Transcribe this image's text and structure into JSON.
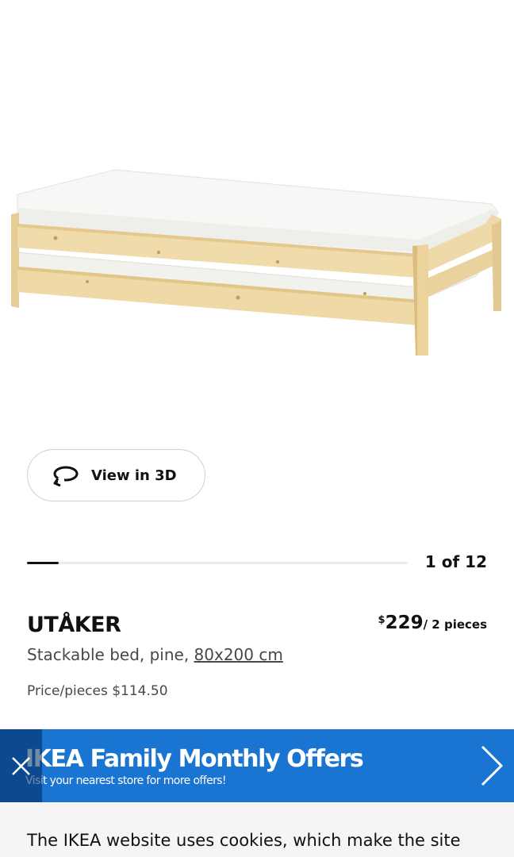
{
  "product": {
    "name": "UTÅKER",
    "description": "Stackable bed, pine, ",
    "size_link": "80x200 cm",
    "price_currency": "$",
    "price_amount": "229",
    "price_unit": "/ 2 pieces",
    "price_per": "Price/pieces $114.50"
  },
  "gallery": {
    "view_3d_label": "View in 3D",
    "counter": "1 of 12",
    "current": 1,
    "total": 12
  },
  "banner": {
    "title": "IKEA Family Monthly Offers",
    "subtitle": "Visit your nearest store for more offers!",
    "background": "#1a74d2"
  },
  "cookie": {
    "text": "The IKEA website uses cookies, which make the site"
  },
  "icons": {
    "view_3d": "rotate-3d-icon",
    "close": "close-icon",
    "next": "chevron-right-icon"
  }
}
